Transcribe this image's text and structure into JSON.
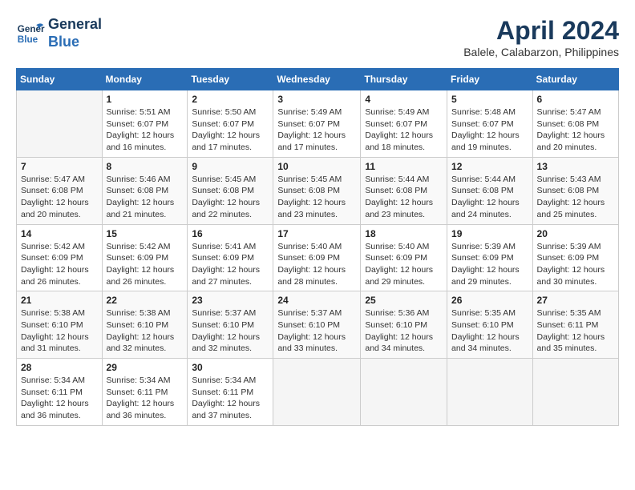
{
  "header": {
    "logo_line1": "General",
    "logo_line2": "Blue",
    "month_year": "April 2024",
    "location": "Balele, Calabarzon, Philippines"
  },
  "calendar": {
    "weekdays": [
      "Sunday",
      "Monday",
      "Tuesday",
      "Wednesday",
      "Thursday",
      "Friday",
      "Saturday"
    ],
    "weeks": [
      [
        {
          "day": "",
          "sunrise": "",
          "sunset": "",
          "daylight": ""
        },
        {
          "day": "1",
          "sunrise": "Sunrise: 5:51 AM",
          "sunset": "Sunset: 6:07 PM",
          "daylight": "Daylight: 12 hours and 16 minutes."
        },
        {
          "day": "2",
          "sunrise": "Sunrise: 5:50 AM",
          "sunset": "Sunset: 6:07 PM",
          "daylight": "Daylight: 12 hours and 17 minutes."
        },
        {
          "day": "3",
          "sunrise": "Sunrise: 5:49 AM",
          "sunset": "Sunset: 6:07 PM",
          "daylight": "Daylight: 12 hours and 17 minutes."
        },
        {
          "day": "4",
          "sunrise": "Sunrise: 5:49 AM",
          "sunset": "Sunset: 6:07 PM",
          "daylight": "Daylight: 12 hours and 18 minutes."
        },
        {
          "day": "5",
          "sunrise": "Sunrise: 5:48 AM",
          "sunset": "Sunset: 6:07 PM",
          "daylight": "Daylight: 12 hours and 19 minutes."
        },
        {
          "day": "6",
          "sunrise": "Sunrise: 5:47 AM",
          "sunset": "Sunset: 6:08 PM",
          "daylight": "Daylight: 12 hours and 20 minutes."
        }
      ],
      [
        {
          "day": "7",
          "sunrise": "Sunrise: 5:47 AM",
          "sunset": "Sunset: 6:08 PM",
          "daylight": "Daylight: 12 hours and 20 minutes."
        },
        {
          "day": "8",
          "sunrise": "Sunrise: 5:46 AM",
          "sunset": "Sunset: 6:08 PM",
          "daylight": "Daylight: 12 hours and 21 minutes."
        },
        {
          "day": "9",
          "sunrise": "Sunrise: 5:45 AM",
          "sunset": "Sunset: 6:08 PM",
          "daylight": "Daylight: 12 hours and 22 minutes."
        },
        {
          "day": "10",
          "sunrise": "Sunrise: 5:45 AM",
          "sunset": "Sunset: 6:08 PM",
          "daylight": "Daylight: 12 hours and 23 minutes."
        },
        {
          "day": "11",
          "sunrise": "Sunrise: 5:44 AM",
          "sunset": "Sunset: 6:08 PM",
          "daylight": "Daylight: 12 hours and 23 minutes."
        },
        {
          "day": "12",
          "sunrise": "Sunrise: 5:44 AM",
          "sunset": "Sunset: 6:08 PM",
          "daylight": "Daylight: 12 hours and 24 minutes."
        },
        {
          "day": "13",
          "sunrise": "Sunrise: 5:43 AM",
          "sunset": "Sunset: 6:08 PM",
          "daylight": "Daylight: 12 hours and 25 minutes."
        }
      ],
      [
        {
          "day": "14",
          "sunrise": "Sunrise: 5:42 AM",
          "sunset": "Sunset: 6:09 PM",
          "daylight": "Daylight: 12 hours and 26 minutes."
        },
        {
          "day": "15",
          "sunrise": "Sunrise: 5:42 AM",
          "sunset": "Sunset: 6:09 PM",
          "daylight": "Daylight: 12 hours and 26 minutes."
        },
        {
          "day": "16",
          "sunrise": "Sunrise: 5:41 AM",
          "sunset": "Sunset: 6:09 PM",
          "daylight": "Daylight: 12 hours and 27 minutes."
        },
        {
          "day": "17",
          "sunrise": "Sunrise: 5:40 AM",
          "sunset": "Sunset: 6:09 PM",
          "daylight": "Daylight: 12 hours and 28 minutes."
        },
        {
          "day": "18",
          "sunrise": "Sunrise: 5:40 AM",
          "sunset": "Sunset: 6:09 PM",
          "daylight": "Daylight: 12 hours and 29 minutes."
        },
        {
          "day": "19",
          "sunrise": "Sunrise: 5:39 AM",
          "sunset": "Sunset: 6:09 PM",
          "daylight": "Daylight: 12 hours and 29 minutes."
        },
        {
          "day": "20",
          "sunrise": "Sunrise: 5:39 AM",
          "sunset": "Sunset: 6:09 PM",
          "daylight": "Daylight: 12 hours and 30 minutes."
        }
      ],
      [
        {
          "day": "21",
          "sunrise": "Sunrise: 5:38 AM",
          "sunset": "Sunset: 6:10 PM",
          "daylight": "Daylight: 12 hours and 31 minutes."
        },
        {
          "day": "22",
          "sunrise": "Sunrise: 5:38 AM",
          "sunset": "Sunset: 6:10 PM",
          "daylight": "Daylight: 12 hours and 32 minutes."
        },
        {
          "day": "23",
          "sunrise": "Sunrise: 5:37 AM",
          "sunset": "Sunset: 6:10 PM",
          "daylight": "Daylight: 12 hours and 32 minutes."
        },
        {
          "day": "24",
          "sunrise": "Sunrise: 5:37 AM",
          "sunset": "Sunset: 6:10 PM",
          "daylight": "Daylight: 12 hours and 33 minutes."
        },
        {
          "day": "25",
          "sunrise": "Sunrise: 5:36 AM",
          "sunset": "Sunset: 6:10 PM",
          "daylight": "Daylight: 12 hours and 34 minutes."
        },
        {
          "day": "26",
          "sunrise": "Sunrise: 5:35 AM",
          "sunset": "Sunset: 6:10 PM",
          "daylight": "Daylight: 12 hours and 34 minutes."
        },
        {
          "day": "27",
          "sunrise": "Sunrise: 5:35 AM",
          "sunset": "Sunset: 6:11 PM",
          "daylight": "Daylight: 12 hours and 35 minutes."
        }
      ],
      [
        {
          "day": "28",
          "sunrise": "Sunrise: 5:34 AM",
          "sunset": "Sunset: 6:11 PM",
          "daylight": "Daylight: 12 hours and 36 minutes."
        },
        {
          "day": "29",
          "sunrise": "Sunrise: 5:34 AM",
          "sunset": "Sunset: 6:11 PM",
          "daylight": "Daylight: 12 hours and 36 minutes."
        },
        {
          "day": "30",
          "sunrise": "Sunrise: 5:34 AM",
          "sunset": "Sunset: 6:11 PM",
          "daylight": "Daylight: 12 hours and 37 minutes."
        },
        {
          "day": "",
          "sunrise": "",
          "sunset": "",
          "daylight": ""
        },
        {
          "day": "",
          "sunrise": "",
          "sunset": "",
          "daylight": ""
        },
        {
          "day": "",
          "sunrise": "",
          "sunset": "",
          "daylight": ""
        },
        {
          "day": "",
          "sunrise": "",
          "sunset": "",
          "daylight": ""
        }
      ]
    ]
  }
}
